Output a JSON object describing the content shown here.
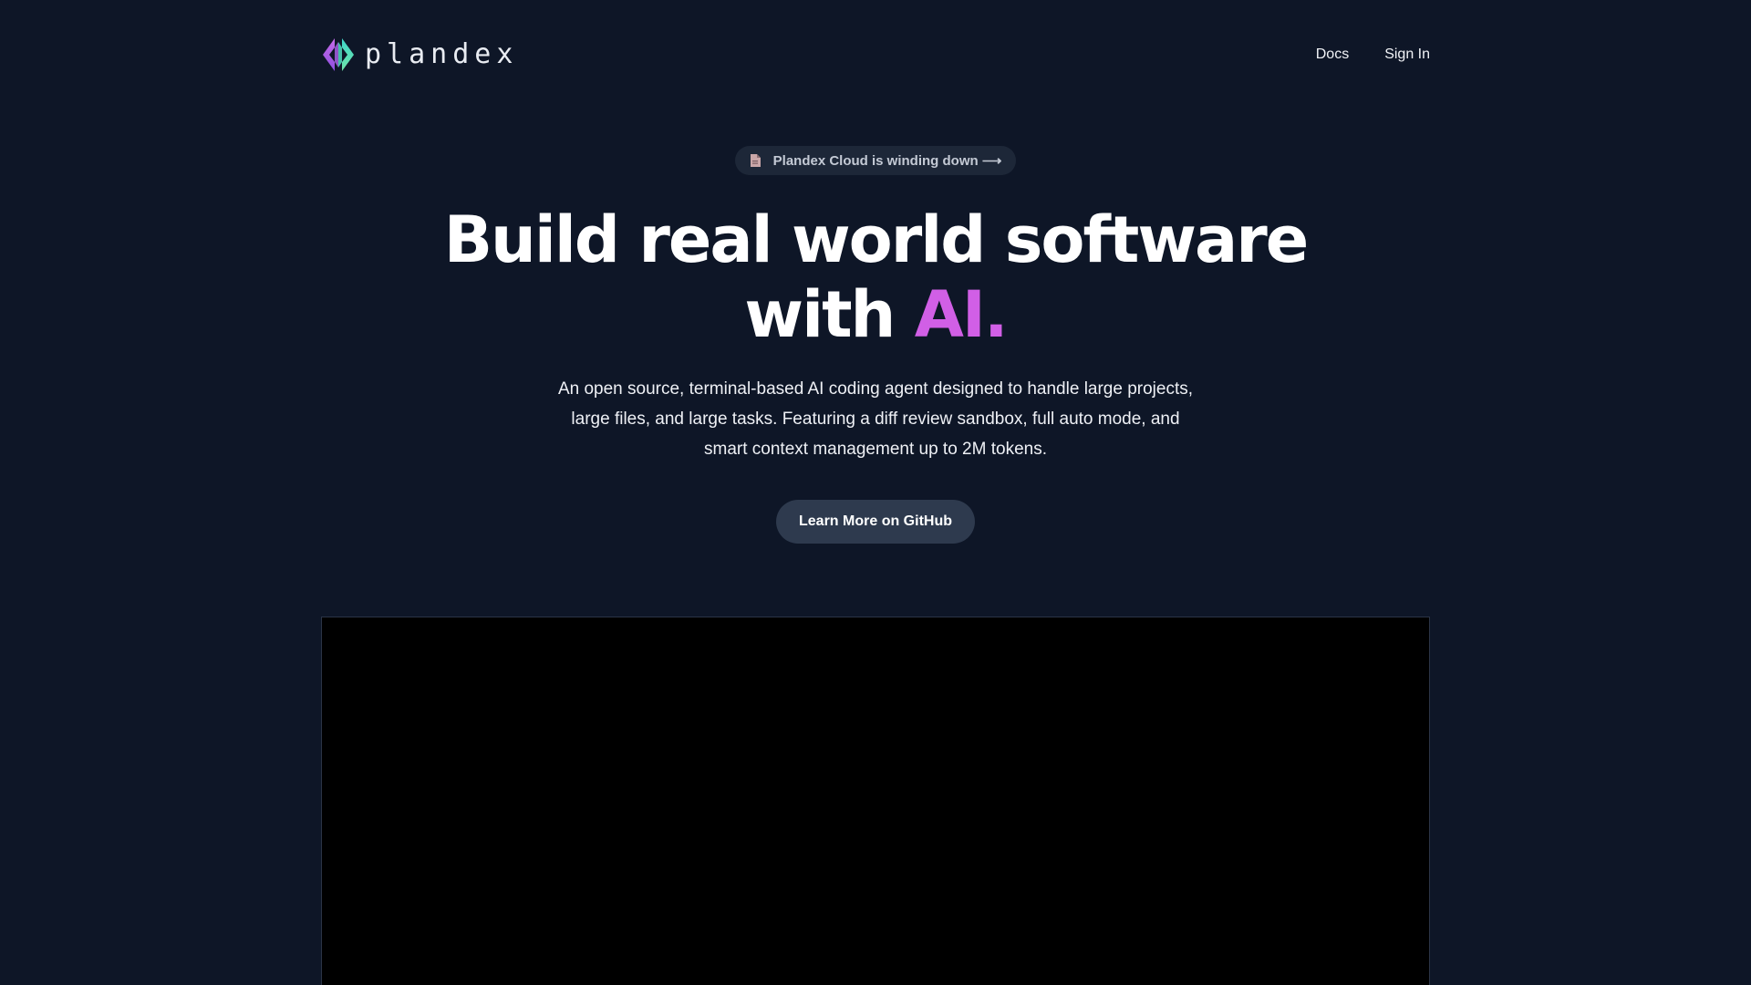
{
  "header": {
    "logo_text": "plandex",
    "logo_icon": "plandex-diamond-logo-icon",
    "nav": [
      {
        "label": "Docs"
      },
      {
        "label": "Sign In"
      }
    ]
  },
  "announcement": {
    "icon": "document-icon",
    "label": "Plandex Cloud is winding down ⟶"
  },
  "hero": {
    "title_line1": "Build real world software",
    "title_line2_prefix": "with ",
    "title_accent": "AI.",
    "description": "An open source, terminal-based AI coding agent designed to handle large projects, large files, and large tasks. Featuring a diff review sandbox, full auto mode, and smart context management up to 2M tokens.",
    "cta_label": "Learn More on GitHub"
  },
  "colors": {
    "background": "#0e1627",
    "accent": "#d15fe6",
    "button_bg": "#2e3a4e",
    "pill_bg": "#1d2738",
    "video_bg": "#000000"
  }
}
